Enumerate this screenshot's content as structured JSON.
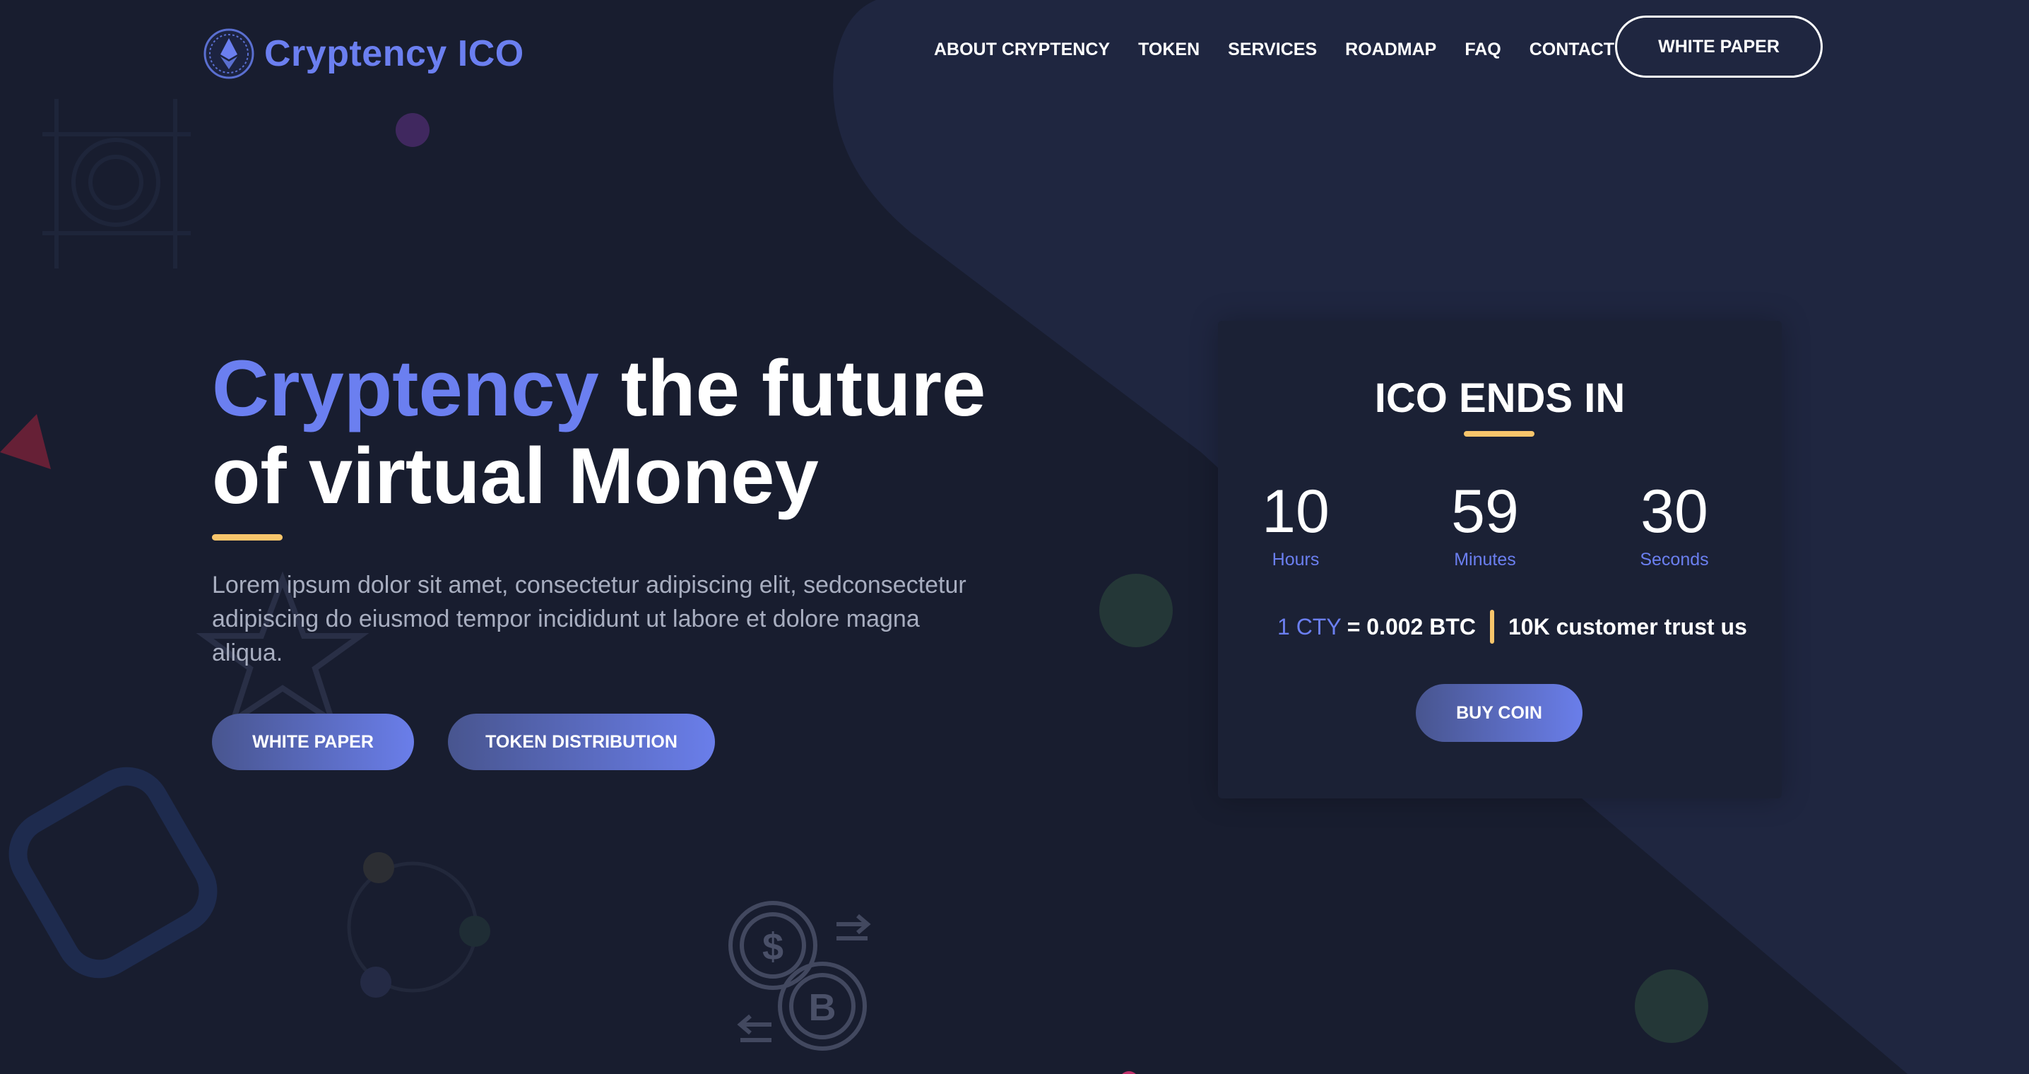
{
  "header": {
    "logo_text": "Cryptency ICO",
    "nav": [
      {
        "label": "ABOUT CRYPTENCY"
      },
      {
        "label": "TOKEN"
      },
      {
        "label": "SERVICES"
      },
      {
        "label": "ROADMAP"
      },
      {
        "label": "FAQ"
      },
      {
        "label": "CONTACT"
      }
    ],
    "cta_label": "WHITE PAPER"
  },
  "hero": {
    "title_accent": "Cryptency",
    "title_rest_line1": " the future",
    "title_line2": "of virtual Money",
    "description": "Lorem ipsum dolor sit amet, consectetur adipiscing elit, sedconsectetur adipiscing do eiusmod tempor incididunt ut labore et dolore magna aliqua.",
    "buttons": {
      "white_paper": "WHITE PAPER",
      "token_distribution": "TOKEN DISTRIBUTION"
    }
  },
  "countdown": {
    "title": "ICO ENDS IN",
    "hours": {
      "value": "10",
      "label": "Hours"
    },
    "minutes": {
      "value": "59",
      "label": "Minutes"
    },
    "seconds": {
      "value": "30",
      "label": "Seconds"
    },
    "rate_token": "1 CTY",
    "rate_value": "= 0.002 BTC",
    "trust_text": "10K customer trust us",
    "buy_label": "BUY COIN"
  },
  "colors": {
    "background": "#181d2f",
    "accent": "#6b7ff0",
    "highlight": "#f8c56b",
    "card": "#1b2135"
  },
  "icons": [
    "ethereum-logo-icon",
    "dollar-bitcoin-exchange-icon"
  ]
}
